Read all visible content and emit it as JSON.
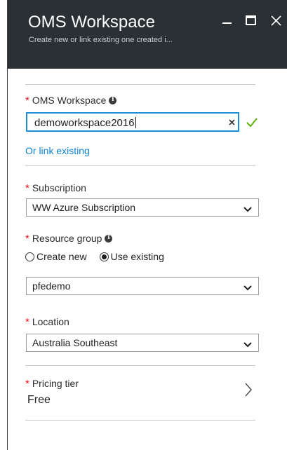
{
  "header": {
    "title": "OMS Workspace",
    "subtitle": "Create new or link existing one created i..."
  },
  "workspace": {
    "label": "OMS Workspace",
    "value": "demoworkspace2016",
    "link_label": "Or link existing"
  },
  "subscription": {
    "label": "Subscription",
    "selected": "WW Azure Subscription"
  },
  "resource_group": {
    "label": "Resource group",
    "options": [
      "Create new",
      "Use existing"
    ],
    "selected_option": "Use existing",
    "selected": "pfedemo"
  },
  "location": {
    "label": "Location",
    "selected": "Australia Southeast"
  },
  "pricing": {
    "label": "Pricing tier",
    "value": "Free"
  },
  "required_marker": "*",
  "colors": {
    "header_bg": "#2b3035",
    "accent": "#1f8ed6",
    "link": "#0f83d1",
    "required": "#e81123",
    "valid": "#5cb000"
  },
  "icons": {
    "minimize": "minimize-icon",
    "maximize": "maximize-icon",
    "close": "close-icon",
    "info": "info-icon",
    "clear": "clear-icon",
    "valid": "checkmark-icon",
    "dropdown": "chevron-down-icon",
    "open": "chevron-right-icon"
  }
}
